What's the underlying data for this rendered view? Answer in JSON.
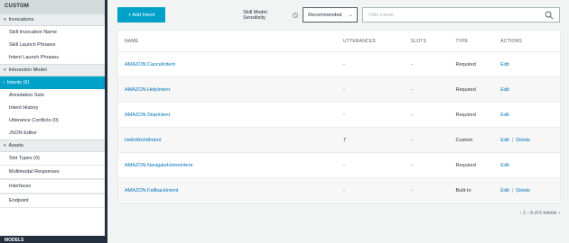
{
  "sidebar": {
    "header": "CUSTOM",
    "footer": "MODELS",
    "invocations": {
      "label": "Invocations",
      "items": [
        "Skill Invocation Name",
        "Skill Launch Phrases",
        "Intent Launch Phrases"
      ]
    },
    "interaction_model": {
      "label": "Interaction Model",
      "items": [
        "Intents (6)",
        "Annotation Sets",
        "Intent History",
        "Utterance Conflicts (0)",
        "JSON Editor"
      ]
    },
    "assets": {
      "label": "Assets",
      "items": [
        "Slot Types (0)"
      ]
    },
    "sections": [
      "Multimodal Responses",
      "Interfaces",
      "Endpoint"
    ]
  },
  "toolbar": {
    "add_label": "+ Add Intent",
    "sensitivity_label": "Skill Model Sensitivity",
    "sensitivity_value": "Recommended",
    "search_placeholder": "Filter intents"
  },
  "table": {
    "headers": [
      "NAME",
      "UTTERANCES",
      "SLOTS",
      "TYPE",
      "ACTIONS"
    ],
    "rows": [
      {
        "name": "AMAZON.CancelIntent",
        "utterances": "-",
        "slots": "-",
        "type": "Required",
        "edit": "Edit",
        "delete": ""
      },
      {
        "name": "AMAZON.HelpIntent",
        "utterances": "-",
        "slots": "-",
        "type": "Required",
        "edit": "Edit",
        "delete": ""
      },
      {
        "name": "AMAZON.StopIntent",
        "utterances": "-",
        "slots": "-",
        "type": "Required",
        "edit": "Edit",
        "delete": ""
      },
      {
        "name": "HelloWorldIntent",
        "utterances": "7",
        "slots": "-",
        "type": "Custom",
        "edit": "Edit",
        "delete": "Delete"
      },
      {
        "name": "AMAZON.NavigateHomeIntent",
        "utterances": "-",
        "slots": "-",
        "type": "Required",
        "edit": "Edit",
        "delete": ""
      },
      {
        "name": "AMAZON.FallbackIntent",
        "utterances": "-",
        "slots": "-",
        "type": "Built-In",
        "edit": "Edit",
        "delete": "Delete"
      }
    ]
  },
  "pager": {
    "text": "1 – 6 of 6 Intents",
    "prev": "‹",
    "next": "›"
  }
}
